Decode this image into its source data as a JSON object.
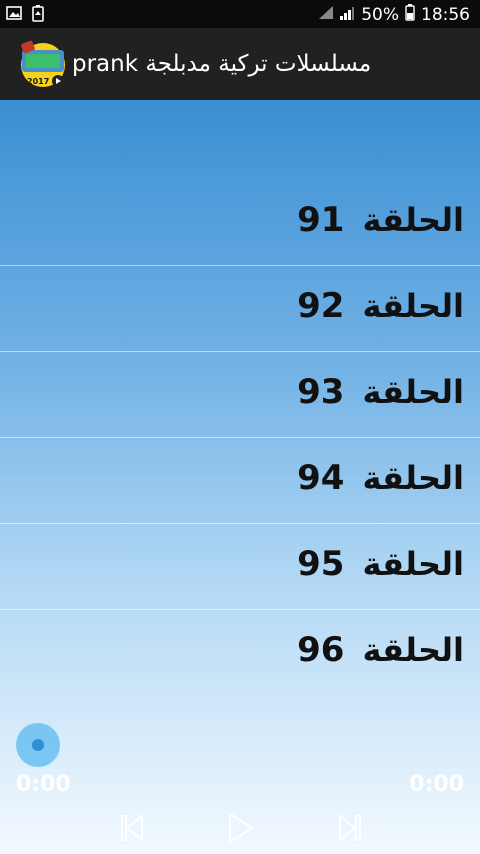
{
  "status_bar": {
    "battery": "50%",
    "time": "18:56",
    "icons": [
      "gallery-icon",
      "battery-saver-icon",
      "wifi-icon",
      "signal-icon",
      "battery-icon"
    ]
  },
  "app_bar": {
    "title": "مسلسلات تركية مدبلجة prank",
    "icon": "app-icon",
    "icon_year": "2017"
  },
  "episodes": [
    {
      "label": "الحلقة",
      "number": "91"
    },
    {
      "label": "الحلقة",
      "number": "92"
    },
    {
      "label": "الحلقة",
      "number": "93"
    },
    {
      "label": "الحلقة",
      "number": "94"
    },
    {
      "label": "الحلقة",
      "number": "95"
    },
    {
      "label": "الحلقة",
      "number": "96"
    }
  ],
  "player": {
    "current_time": "0:00",
    "total_time": "0:00",
    "progress": 0,
    "controls": [
      "previous-icon",
      "play-icon",
      "next-icon"
    ]
  },
  "colors": {
    "status_bar_bg": "#0b0b0b",
    "app_bar_bg": "#212121",
    "gradient_top": "#3a8fd3",
    "gradient_bottom": "#f3f9fe",
    "seek_thumb": "#2d8fd6"
  }
}
